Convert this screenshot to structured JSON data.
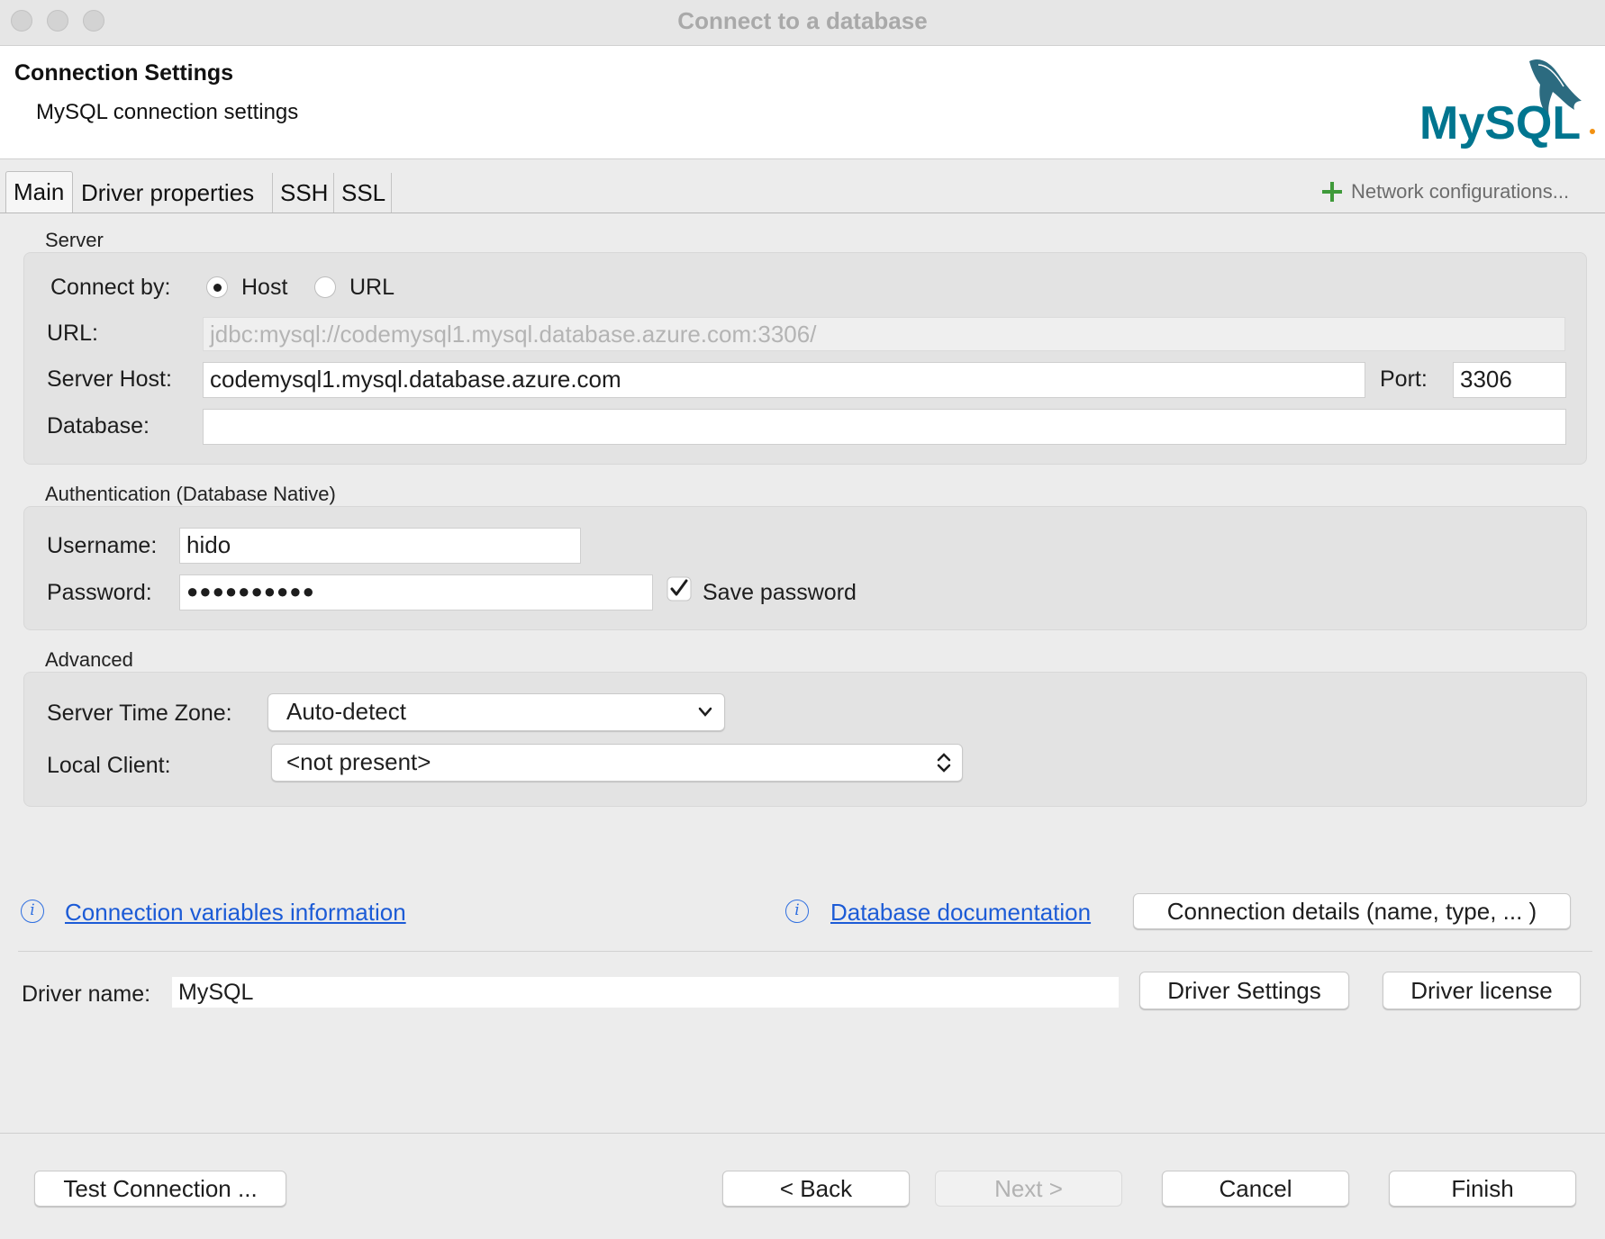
{
  "window": {
    "title": "Connect to a database"
  },
  "header": {
    "title": "Connection Settings",
    "subtitle": "MySQL connection settings",
    "logo_text": "MySQL"
  },
  "tabs": [
    {
      "label": "Main",
      "active": true
    },
    {
      "label": "Driver properties",
      "active": false
    },
    {
      "label": "SSH",
      "active": false
    },
    {
      "label": "SSL",
      "active": false
    }
  ],
  "network_configurations": {
    "label": "Network configurations...",
    "icon": "plus-icon",
    "icon_color": "#3f9a3a"
  },
  "server": {
    "group_label": "Server",
    "connect_by_label": "Connect by:",
    "connect_by_options": [
      {
        "label": "Host",
        "selected": true
      },
      {
        "label": "URL",
        "selected": false
      }
    ],
    "url_label": "URL:",
    "url_value": "jdbc:mysql://codemysql1.mysql.database.azure.com:3306/",
    "host_label": "Server Host:",
    "host_value": "codemysql1.mysql.database.azure.com",
    "port_label": "Port:",
    "port_value": "3306",
    "database_label": "Database:",
    "database_value": ""
  },
  "auth": {
    "group_label": "Authentication (Database Native)",
    "username_label": "Username:",
    "username_value": "hido",
    "password_label": "Password:",
    "password_value": "●●●●●●●●●●",
    "save_password_label": "Save password",
    "save_password_checked": true
  },
  "advanced": {
    "group_label": "Advanced",
    "timezone_label": "Server Time Zone:",
    "timezone_value": "Auto-detect",
    "local_client_label": "Local Client:",
    "local_client_value": "<not present>"
  },
  "links": {
    "variables_info": "Connection variables information",
    "db_docs": "Database documentation",
    "connection_details": "Connection details (name, type, ... )"
  },
  "driver": {
    "name_label": "Driver name:",
    "name_value": "MySQL",
    "settings_button": "Driver Settings",
    "license_button": "Driver license"
  },
  "footer": {
    "test_connection": "Test Connection ...",
    "back": "< Back",
    "next": "Next >",
    "cancel": "Cancel",
    "finish": "Finish"
  },
  "colors": {
    "link": "#1c5bd6",
    "mysql_blue": "#00758f",
    "mysql_orange": "#f29111"
  }
}
